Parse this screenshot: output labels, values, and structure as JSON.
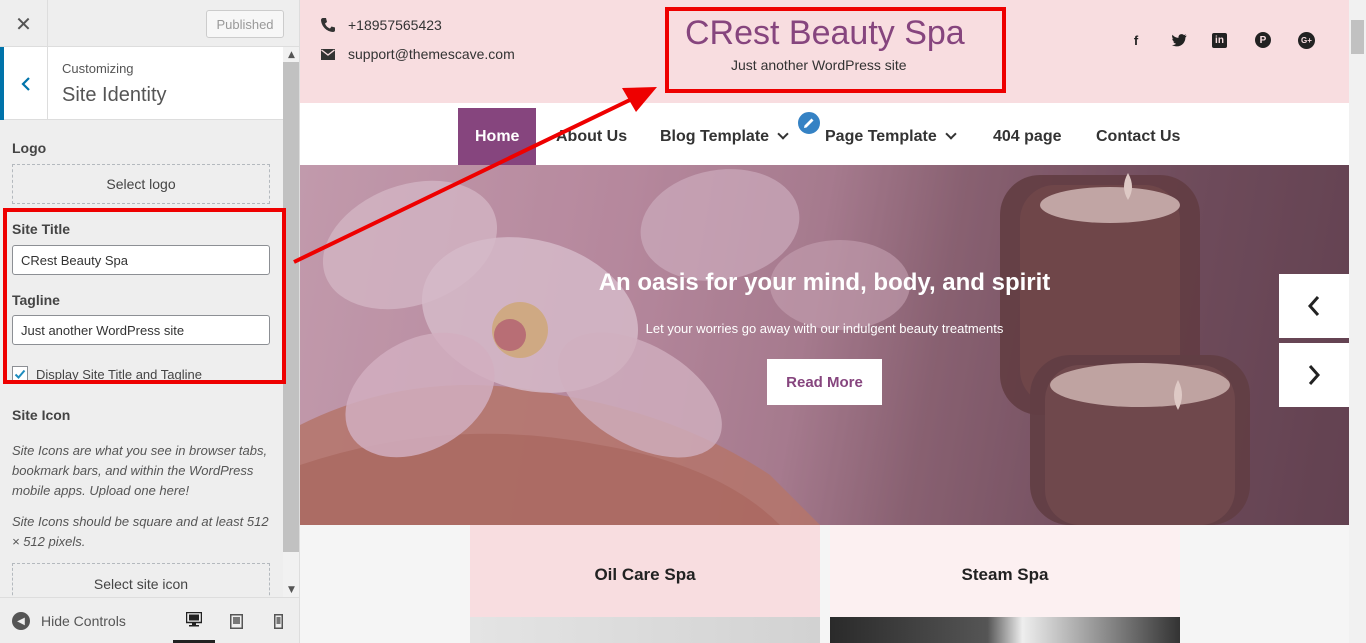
{
  "customizer": {
    "close_icon": "close-icon",
    "publish_label": "Published",
    "back_icon": "chevron-left-icon",
    "customizing_label": "Customizing",
    "section_title": "Site Identity",
    "logo": {
      "label": "Logo",
      "button": "Select logo"
    },
    "site_title": {
      "label": "Site Title",
      "value": "CRest Beauty Spa"
    },
    "tagline": {
      "label": "Tagline",
      "value": "Just another WordPress site"
    },
    "display_checkbox": {
      "label": "Display Site Title and Tagline",
      "checked": true
    },
    "site_icon": {
      "label": "Site Icon",
      "desc1": "Site Icons are what you see in browser tabs, bookmark bars, and within the WordPress mobile apps. Upload one here!",
      "desc2": "Site Icons should be square and at least 512 × 512 pixels.",
      "button": "Select site icon"
    },
    "footer": {
      "hide_controls": "Hide Controls",
      "devices": [
        "desktop",
        "tablet",
        "mobile"
      ],
      "active_device": "desktop"
    }
  },
  "preview": {
    "phone": "+18957565423",
    "email": "support@themescave.com",
    "site_title": "CRest Beauty Spa",
    "tagline": "Just another WordPress site",
    "social_icons": [
      "facebook-icon",
      "twitter-icon",
      "linkedin-icon",
      "pinterest-icon",
      "google-plus-icon"
    ],
    "social_glyphs": {
      "facebook": "f",
      "twitter": "t",
      "linkedin": "in",
      "pinterest": "P",
      "google": "G+"
    },
    "nav": {
      "home": "Home",
      "about": "About Us",
      "blog": "Blog Template",
      "page": "Page Template",
      "404": "404 page",
      "contact": "Contact Us"
    },
    "hero": {
      "heading": "An oasis for your mind, body, and spirit",
      "subheading": "Let your worries go away with our indulgent beauty treatments",
      "button": "Read More"
    },
    "cards": [
      {
        "title": "Oil Care Spa"
      },
      {
        "title": "Steam Spa"
      }
    ]
  },
  "colors": {
    "accent": "#86457e",
    "header_bg": "#f8dde0",
    "highlight_red": "#ee0000",
    "wp_blue": "#0073aa"
  }
}
